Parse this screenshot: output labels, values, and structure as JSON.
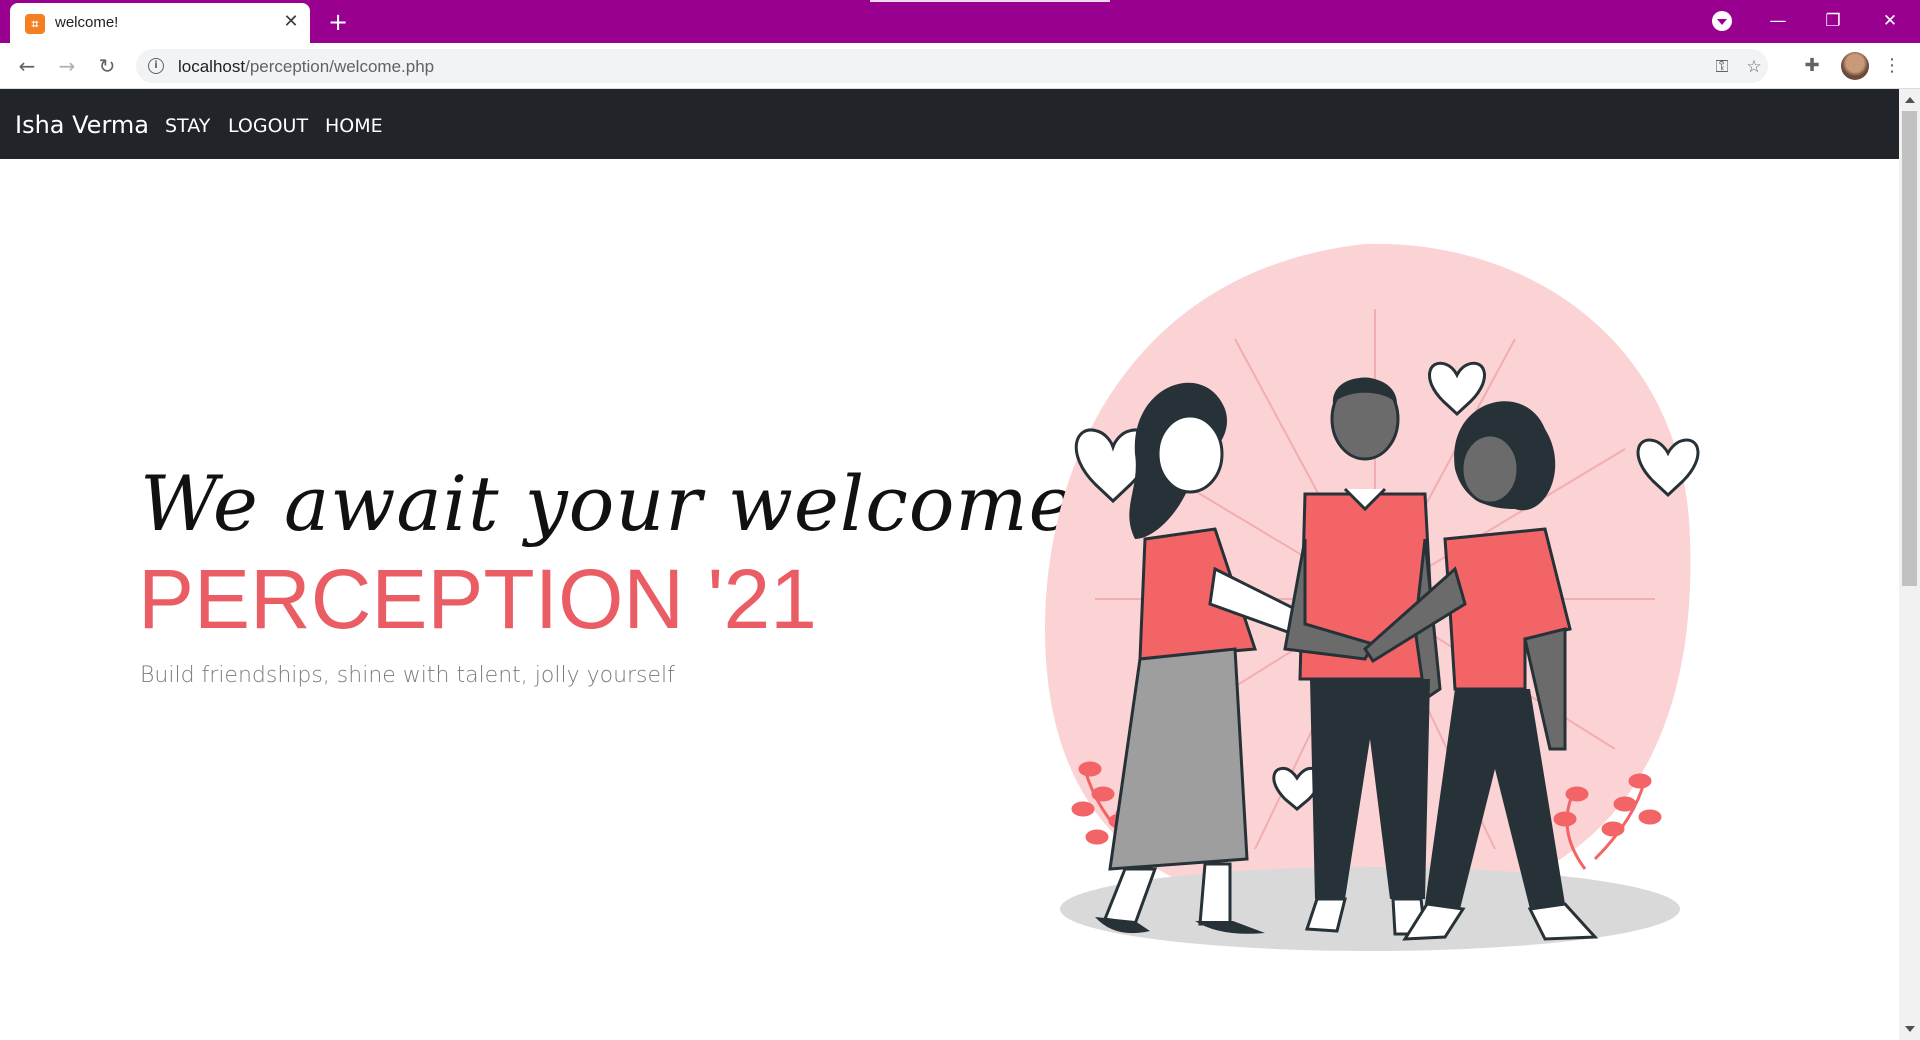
{
  "browser": {
    "tab": {
      "title": "welcome!",
      "favicon": "xampp-icon",
      "close": "✕"
    },
    "new_tab": "+",
    "window_controls": {
      "minimize": "—",
      "restore": "❐",
      "close": "✕"
    },
    "nav": {
      "back": "←",
      "forward": "→",
      "reload": "↻"
    },
    "address": {
      "host": "localhost",
      "path": "/perception/welcome.php"
    },
    "accent_color": "#9a0090"
  },
  "page": {
    "navbar": {
      "brand": "Isha Verma",
      "links": [
        "STAY",
        "LOGOUT",
        "HOME"
      ],
      "background": "#212529"
    },
    "hero": {
      "script_line": "We await your welcome at",
      "title": "PERCEPTION '21",
      "subtitle": "Build friendships, shine with talent, jolly yourself",
      "title_color": "#ea5d64"
    },
    "illustration": {
      "subject": "three-friends-hands-together",
      "colors": {
        "accent": "#f26466",
        "blob": "#fbd3d5",
        "dark": "#263238",
        "shadow": "#d9d9d9"
      }
    }
  }
}
